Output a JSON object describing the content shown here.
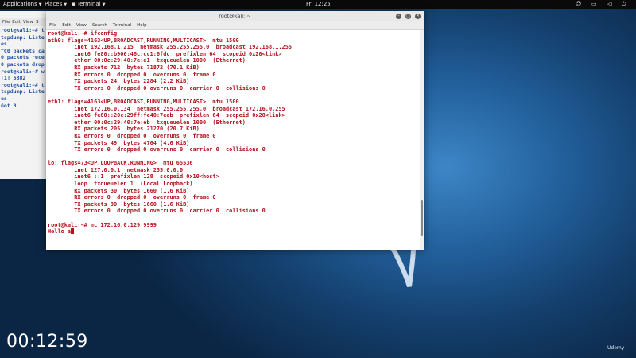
{
  "topbar": {
    "applications": "Applications",
    "places": "Places",
    "terminal": "Terminal",
    "clock": "Fri 12:25"
  },
  "bg_terminal": {
    "menu": [
      "File",
      "Edit",
      "View",
      "S"
    ],
    "lines": [
      "root@kali:~# t",
      "tcpdump: Liste",
      "es",
      "^C0 packets ca",
      "0 packets rece",
      "0 packets drop",
      "root@kali:~# w",
      "[1] 6382",
      "root@kali:~# t",
      "tcpdump: Liste",
      "es",
      "Got 3"
    ]
  },
  "terminal": {
    "title": "root@kali: ~",
    "menu": [
      "File",
      "Edit",
      "View",
      "Search",
      "Terminal",
      "Help"
    ],
    "lines": [
      "root@kali:~# ifconfig",
      "eth0: flags=4163<UP,BROADCAST,RUNNING,MULTICAST>  mtu 1500",
      "        inet 192.168.1.215  netmask 255.255.255.0  broadcast 192.168.1.255",
      "        inet6 fe80::b906:46c:cc1:6fdc  prefixlen 64  scopeid 0x20<link>",
      "        ether 00:0c:29:40:7e:e1  txqueuelen 1000  (Ethernet)",
      "        RX packets 712  bytes 71872 (70.1 KiB)",
      "        RX errors 0  dropped 0  overruns 0  frame 0",
      "        TX packets 24  bytes 2284 (2.2 KiB)",
      "        TX errors 0  dropped 0 overruns 0  carrier 0  collisions 0",
      "",
      "eth1: flags=4163<UP,BROADCAST,RUNNING,MULTICAST>  mtu 1500",
      "        inet 172.16.0.134  netmask 255.255.255.0  broadcast 172.16.0.255",
      "        inet6 fe80::20c:29ff:fe40:7eeb  prefixlen 64  scopeid 0x20<link>",
      "        ether 00:0c:29:40:7e:eb  txqueuelen 1000  (Ethernet)",
      "        RX packets 205  bytes 21270 (20.7 KiB)",
      "        RX errors 0  dropped 0  overruns 0  frame 0",
      "        TX packets 49  bytes 4764 (4.6 KiB)",
      "        TX errors 0  dropped 0 overruns 0  carrier 0  collisions 0",
      "",
      "lo: flags=73<UP,LOOPBACK,RUNNING>  mtu 65536",
      "        inet 127.0.0.1  netmask 255.0.0.0",
      "        inet6 ::1  prefixlen 128  scopeid 0x10<host>",
      "        loop  txqueuelen 1  (Local Loopback)",
      "        RX packets 30  bytes 1660 (1.6 KiB)",
      "        RX errors 0  dropped 0  overruns 0  frame 0",
      "        TX packets 30  bytes 1660 (1.6 KiB)",
      "        TX errors 0  dropped 0 overruns 0  carrier 0  collisions 0",
      "",
      "root@kali:~# nc 172.16.0.129 9999"
    ],
    "input_line": "Hello a"
  },
  "overlay": {
    "timer": "00:12:59",
    "watermark": "Udemy"
  },
  "colors": {
    "prompt_red": "#b0141e",
    "bg_text_blue": "#1c4fa0"
  }
}
